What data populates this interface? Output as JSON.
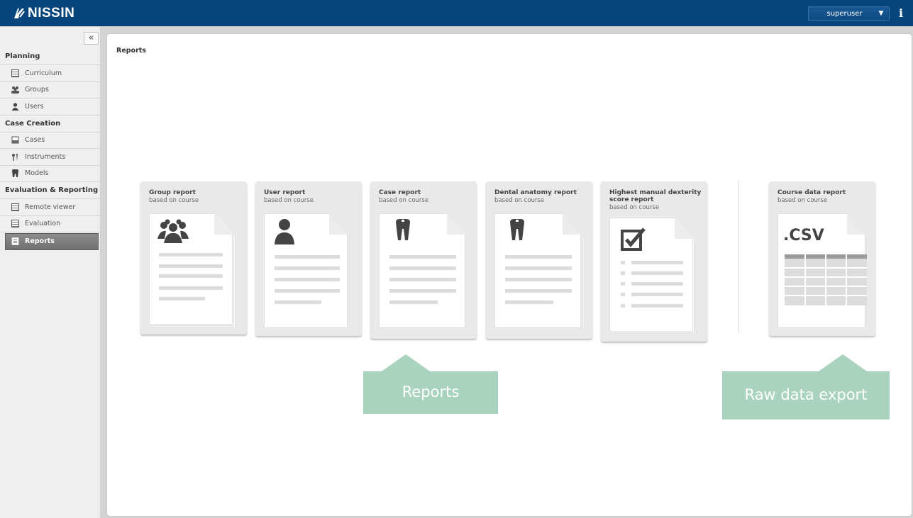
{
  "header": {
    "brand": "NISSIN",
    "user": "superuser",
    "info_label": "i"
  },
  "sidebar": {
    "collapse_label": "«",
    "sections": [
      {
        "title": "Planning",
        "items": [
          {
            "label": "Curriculum",
            "icon": "curriculum-icon"
          },
          {
            "label": "Groups",
            "icon": "groups-icon"
          },
          {
            "label": "Users",
            "icon": "user-icon"
          }
        ]
      },
      {
        "title": "Case Creation",
        "items": [
          {
            "label": "Cases",
            "icon": "cases-icon"
          },
          {
            "label": "Instruments",
            "icon": "instruments-icon"
          },
          {
            "label": "Models",
            "icon": "tooth-icon"
          }
        ]
      },
      {
        "title": "Evaluation & Reporting",
        "items": [
          {
            "label": "Remote viewer",
            "icon": "remote-viewer-icon"
          },
          {
            "label": "Evaluation",
            "icon": "evaluation-icon"
          },
          {
            "label": "Reports",
            "icon": "reports-icon",
            "active": true
          }
        ]
      }
    ]
  },
  "main": {
    "title": "Reports",
    "cards": [
      {
        "title": "Group report",
        "subtitle": "based on course",
        "icon": "group-icon"
      },
      {
        "title": "User report",
        "subtitle": "based on course",
        "icon": "user-icon"
      },
      {
        "title": "Case report",
        "subtitle": "based on course",
        "icon": "tooth-icon"
      },
      {
        "title": "Dental anatomy report",
        "subtitle": "based on course",
        "icon": "tooth-icon"
      },
      {
        "title": "Highest manual dexterity score report",
        "subtitle": "based on course",
        "icon": "checkbox-icon"
      },
      {
        "title": "Course data report",
        "subtitle": "based on course",
        "icon": "csv-table-icon",
        "file_label": ".CSV"
      }
    ],
    "callouts": {
      "reports": "Reports",
      "raw": "Raw data export"
    }
  },
  "colors": {
    "header_bg": "#07457d",
    "callout": "#a9d3bf",
    "card_bg": "#e9e9e9"
  }
}
